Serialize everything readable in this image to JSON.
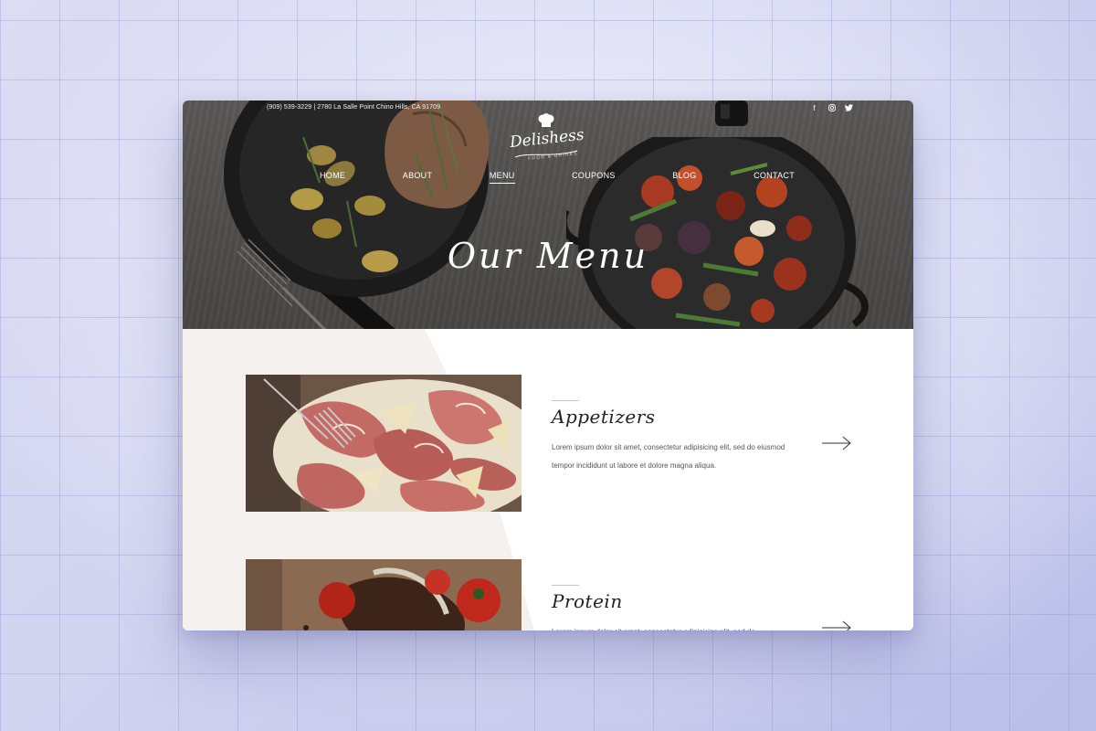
{
  "topbar": {
    "contact": "(909) 539-3229 | 2780 La Salle Point Chino Hills, CA 91709",
    "social_icons": [
      "facebook-icon",
      "instagram-icon",
      "twitter-icon"
    ]
  },
  "logo": {
    "brand": "Delishess",
    "tagline": "FOOD & DRINKS"
  },
  "nav": {
    "items": [
      {
        "label": "HOME"
      },
      {
        "label": "ABOUT"
      },
      {
        "label": "MENU",
        "active": true
      },
      {
        "label": "COUPONS"
      },
      {
        "label": "BLOG"
      },
      {
        "label": "CONTACT"
      }
    ]
  },
  "hero": {
    "title": "Our Menu"
  },
  "menu_sections": [
    {
      "title": "Appetizers",
      "description": "Lorem ipsum dolor sit amet, consectetur adipisicing elit, sed do eiusmod tempor incididunt ut labore et dolore magna aliqua.",
      "icon": "arrow-right-icon"
    },
    {
      "title": "Protein",
      "description": "Lorem ipsum dolor sit amet, consectetur adipisicing elit, sed do",
      "icon": "arrow-right-icon"
    }
  ],
  "colors": {
    "hero_overlay": "#4e4c4a",
    "beige_panel": "#f4f1ee",
    "text_dark": "#222222",
    "text_body": "#555555",
    "divider": "#c6c6cc"
  }
}
